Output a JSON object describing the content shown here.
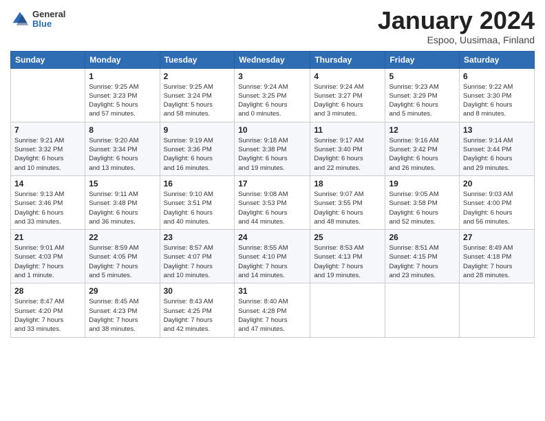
{
  "logo": {
    "general": "General",
    "blue": "Blue"
  },
  "header": {
    "title": "January 2024",
    "location": "Espoo, Uusimaa, Finland"
  },
  "weekdays": [
    "Sunday",
    "Monday",
    "Tuesday",
    "Wednesday",
    "Thursday",
    "Friday",
    "Saturday"
  ],
  "weeks": [
    [
      {
        "day": "",
        "info": ""
      },
      {
        "day": "1",
        "info": "Sunrise: 9:25 AM\nSunset: 3:23 PM\nDaylight: 5 hours\nand 57 minutes."
      },
      {
        "day": "2",
        "info": "Sunrise: 9:25 AM\nSunset: 3:24 PM\nDaylight: 5 hours\nand 58 minutes."
      },
      {
        "day": "3",
        "info": "Sunrise: 9:24 AM\nSunset: 3:25 PM\nDaylight: 6 hours\nand 0 minutes."
      },
      {
        "day": "4",
        "info": "Sunrise: 9:24 AM\nSunset: 3:27 PM\nDaylight: 6 hours\nand 3 minutes."
      },
      {
        "day": "5",
        "info": "Sunrise: 9:23 AM\nSunset: 3:29 PM\nDaylight: 6 hours\nand 5 minutes."
      },
      {
        "day": "6",
        "info": "Sunrise: 9:22 AM\nSunset: 3:30 PM\nDaylight: 6 hours\nand 8 minutes."
      }
    ],
    [
      {
        "day": "7",
        "info": "Sunrise: 9:21 AM\nSunset: 3:32 PM\nDaylight: 6 hours\nand 10 minutes."
      },
      {
        "day": "8",
        "info": "Sunrise: 9:20 AM\nSunset: 3:34 PM\nDaylight: 6 hours\nand 13 minutes."
      },
      {
        "day": "9",
        "info": "Sunrise: 9:19 AM\nSunset: 3:36 PM\nDaylight: 6 hours\nand 16 minutes."
      },
      {
        "day": "10",
        "info": "Sunrise: 9:18 AM\nSunset: 3:38 PM\nDaylight: 6 hours\nand 19 minutes."
      },
      {
        "day": "11",
        "info": "Sunrise: 9:17 AM\nSunset: 3:40 PM\nDaylight: 6 hours\nand 22 minutes."
      },
      {
        "day": "12",
        "info": "Sunrise: 9:16 AM\nSunset: 3:42 PM\nDaylight: 6 hours\nand 26 minutes."
      },
      {
        "day": "13",
        "info": "Sunrise: 9:14 AM\nSunset: 3:44 PM\nDaylight: 6 hours\nand 29 minutes."
      }
    ],
    [
      {
        "day": "14",
        "info": "Sunrise: 9:13 AM\nSunset: 3:46 PM\nDaylight: 6 hours\nand 33 minutes."
      },
      {
        "day": "15",
        "info": "Sunrise: 9:11 AM\nSunset: 3:48 PM\nDaylight: 6 hours\nand 36 minutes."
      },
      {
        "day": "16",
        "info": "Sunrise: 9:10 AM\nSunset: 3:51 PM\nDaylight: 6 hours\nand 40 minutes."
      },
      {
        "day": "17",
        "info": "Sunrise: 9:08 AM\nSunset: 3:53 PM\nDaylight: 6 hours\nand 44 minutes."
      },
      {
        "day": "18",
        "info": "Sunrise: 9:07 AM\nSunset: 3:55 PM\nDaylight: 6 hours\nand 48 minutes."
      },
      {
        "day": "19",
        "info": "Sunrise: 9:05 AM\nSunset: 3:58 PM\nDaylight: 6 hours\nand 52 minutes."
      },
      {
        "day": "20",
        "info": "Sunrise: 9:03 AM\nSunset: 4:00 PM\nDaylight: 6 hours\nand 56 minutes."
      }
    ],
    [
      {
        "day": "21",
        "info": "Sunrise: 9:01 AM\nSunset: 4:03 PM\nDaylight: 7 hours\nand 1 minute."
      },
      {
        "day": "22",
        "info": "Sunrise: 8:59 AM\nSunset: 4:05 PM\nDaylight: 7 hours\nand 5 minutes."
      },
      {
        "day": "23",
        "info": "Sunrise: 8:57 AM\nSunset: 4:07 PM\nDaylight: 7 hours\nand 10 minutes."
      },
      {
        "day": "24",
        "info": "Sunrise: 8:55 AM\nSunset: 4:10 PM\nDaylight: 7 hours\nand 14 minutes."
      },
      {
        "day": "25",
        "info": "Sunrise: 8:53 AM\nSunset: 4:13 PM\nDaylight: 7 hours\nand 19 minutes."
      },
      {
        "day": "26",
        "info": "Sunrise: 8:51 AM\nSunset: 4:15 PM\nDaylight: 7 hours\nand 23 minutes."
      },
      {
        "day": "27",
        "info": "Sunrise: 8:49 AM\nSunset: 4:18 PM\nDaylight: 7 hours\nand 28 minutes."
      }
    ],
    [
      {
        "day": "28",
        "info": "Sunrise: 8:47 AM\nSunset: 4:20 PM\nDaylight: 7 hours\nand 33 minutes."
      },
      {
        "day": "29",
        "info": "Sunrise: 8:45 AM\nSunset: 4:23 PM\nDaylight: 7 hours\nand 38 minutes."
      },
      {
        "day": "30",
        "info": "Sunrise: 8:43 AM\nSunset: 4:25 PM\nDaylight: 7 hours\nand 42 minutes."
      },
      {
        "day": "31",
        "info": "Sunrise: 8:40 AM\nSunset: 4:28 PM\nDaylight: 7 hours\nand 47 minutes."
      },
      {
        "day": "",
        "info": ""
      },
      {
        "day": "",
        "info": ""
      },
      {
        "day": "",
        "info": ""
      }
    ]
  ]
}
